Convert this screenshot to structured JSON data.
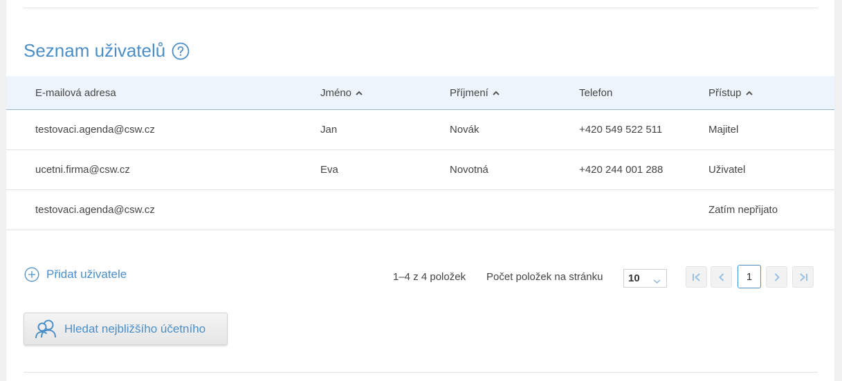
{
  "section": {
    "title": "Seznam uživatelů"
  },
  "table": {
    "columns": [
      {
        "label": "E-mailová adresa",
        "sortable": false
      },
      {
        "label": "Jméno",
        "sortable": true
      },
      {
        "label": "Příjmení",
        "sortable": true
      },
      {
        "label": "Telefon",
        "sortable": false
      },
      {
        "label": "Přístup",
        "sortable": true
      }
    ],
    "rows": [
      {
        "email": "testovaci.agenda@csw.cz",
        "first_name": "Jan",
        "last_name": "Novák",
        "phone": "+420 549 522 511",
        "access": "Majitel"
      },
      {
        "email": "ucetni.firma@csw.cz",
        "first_name": "Eva",
        "last_name": "Novotná",
        "phone": "+420 244 001 288",
        "access": "Uživatel"
      },
      {
        "email": "testovaci.agenda@csw.cz",
        "first_name": "",
        "last_name": "",
        "phone": "",
        "access": "Zatím nepřijato"
      }
    ]
  },
  "actions": {
    "add_user_label": "Přidat uživatele",
    "find_accountant_label": "Hledat nejbližšího účetního"
  },
  "pagination": {
    "count_text": "1–4 z 4 položek",
    "per_page_label": "Počet položek na stránku",
    "per_page_value": "10",
    "current_page": "1"
  },
  "colors": {
    "accent": "#4a8ec8",
    "header_bg": "#eef4fb"
  }
}
